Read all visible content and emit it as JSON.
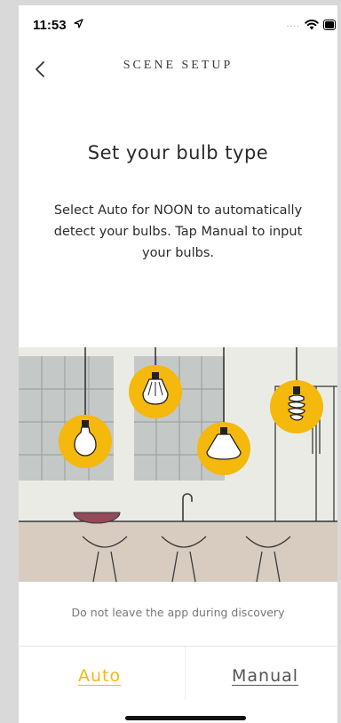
{
  "status_bar": {
    "time": "11:53",
    "signal": "....",
    "icons": [
      "location-arrow-icon",
      "wifi-icon",
      "battery-icon"
    ]
  },
  "header": {
    "back_icon": "chevron-left-icon",
    "title": "SCENE SETUP"
  },
  "main": {
    "heading": "Set your bulb type",
    "description": "Select Auto for NOON to automatically detect your bulbs. Tap Manual to input your bulbs."
  },
  "illustration": {
    "subject": "kitchen-pendant-bulbs",
    "accent_color": "#F5B80C"
  },
  "footer": {
    "notice": "Do not leave the app during discovery",
    "auto_label": "Auto",
    "manual_label": "Manual"
  },
  "colors": {
    "accent": "#F2B90F",
    "text": "#2B2B2B",
    "muted": "#777777"
  }
}
